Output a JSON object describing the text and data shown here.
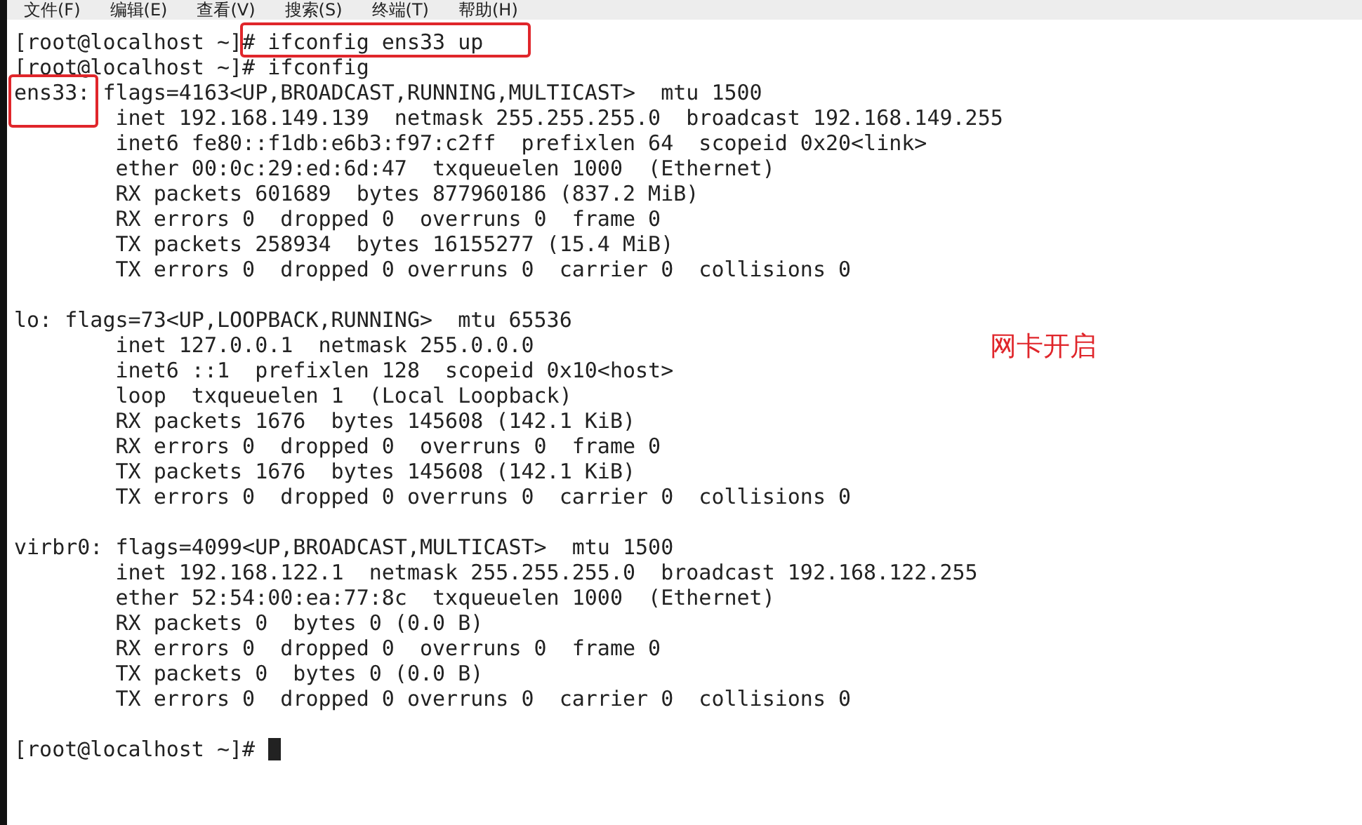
{
  "menu": [
    "文件(F)",
    "编辑(E)",
    "查看(V)",
    "搜索(S)",
    "终端(T)",
    "帮助(H)"
  ],
  "terminal": {
    "blocks": [
      {
        "lines": [
          {
            "parts": [
              {
                "text": "[root@localhost ~]",
                "highlighted": false
              },
              {
                "text": "# ifconfig ens33 up",
                "highlighted": true
              }
            ]
          },
          {
            "parts": [
              {
                "text": "[root@localhost ~]# ifconfig",
                "highlighted": false
              }
            ]
          },
          {
            "parts": [
              {
                "text": "ens33:",
                "highlighted": true
              },
              {
                "text": " flags=4163<UP,BROADCAST,RUNNING,MULTICAST>  mtu 1500",
                "highlighted": false
              }
            ]
          },
          {
            "parts": [
              {
                "text": "        inet 192.168.149.139  netmask 255.255.255.0  broadcast 192.168.149.255",
                "highlighted": false
              }
            ]
          },
          {
            "parts": [
              {
                "text": "        inet6 fe80::f1db:e6b3:f97:c2ff  prefixlen 64  scopeid 0x20<link>",
                "highlighted": false
              }
            ]
          },
          {
            "parts": [
              {
                "text": "        ether 00:0c:29:ed:6d:47  txqueuelen 1000  (Ethernet)",
                "highlighted": false
              }
            ]
          },
          {
            "parts": [
              {
                "text": "        RX packets 601689  bytes 877960186 (837.2 MiB)",
                "highlighted": false
              }
            ]
          },
          {
            "parts": [
              {
                "text": "        RX errors 0  dropped 0  overruns 0  frame 0",
                "highlighted": false
              }
            ]
          },
          {
            "parts": [
              {
                "text": "        TX packets 258934  bytes 16155277 (15.4 MiB)",
                "highlighted": false
              }
            ]
          },
          {
            "parts": [
              {
                "text": "        TX errors 0  dropped 0 overruns 0  carrier 0  collisions 0",
                "highlighted": false
              }
            ]
          }
        ]
      },
      {
        "lines": [
          {
            "parts": [
              {
                "text": "lo: flags=73<UP,LOOPBACK,RUNNING>  mtu 65536",
                "highlighted": false
              }
            ]
          },
          {
            "parts": [
              {
                "text": "        inet 127.0.0.1  netmask 255.0.0.0",
                "highlighted": false
              }
            ]
          },
          {
            "parts": [
              {
                "text": "        inet6 ::1  prefixlen 128  scopeid 0x10<host>",
                "highlighted": false
              }
            ]
          },
          {
            "parts": [
              {
                "text": "        loop  txqueuelen 1  (Local Loopback)",
                "highlighted": false
              }
            ]
          },
          {
            "parts": [
              {
                "text": "        RX packets 1676  bytes 145608 (142.1 KiB)",
                "highlighted": false
              }
            ]
          },
          {
            "parts": [
              {
                "text": "        RX errors 0  dropped 0  overruns 0  frame 0",
                "highlighted": false
              }
            ]
          },
          {
            "parts": [
              {
                "text": "        TX packets 1676  bytes 145608 (142.1 KiB)",
                "highlighted": false
              }
            ]
          },
          {
            "parts": [
              {
                "text": "        TX errors 0  dropped 0 overruns 0  carrier 0  collisions 0",
                "highlighted": false
              }
            ]
          }
        ]
      },
      {
        "lines": [
          {
            "parts": [
              {
                "text": "virbr0: flags=4099<UP,BROADCAST,MULTICAST>  mtu 1500",
                "highlighted": false
              }
            ]
          },
          {
            "parts": [
              {
                "text": "        inet 192.168.122.1  netmask 255.255.255.0  broadcast 192.168.122.255",
                "highlighted": false
              }
            ]
          },
          {
            "parts": [
              {
                "text": "        ether 52:54:00:ea:77:8c  txqueuelen 1000  (Ethernet)",
                "highlighted": false
              }
            ]
          },
          {
            "parts": [
              {
                "text": "        RX packets 0  bytes 0 (0.0 B)",
                "highlighted": false
              }
            ]
          },
          {
            "parts": [
              {
                "text": "        RX errors 0  dropped 0  overruns 0  frame 0",
                "highlighted": false
              }
            ]
          },
          {
            "parts": [
              {
                "text": "        TX packets 0  bytes 0 (0.0 B)",
                "highlighted": false
              }
            ]
          },
          {
            "parts": [
              {
                "text": "        TX errors 0  dropped 0 overruns 0  carrier 0  collisions 0",
                "highlighted": false
              }
            ]
          }
        ]
      }
    ],
    "prompt": "[root@localhost ~]#",
    "cursor": true
  },
  "annotation": "网卡开启"
}
